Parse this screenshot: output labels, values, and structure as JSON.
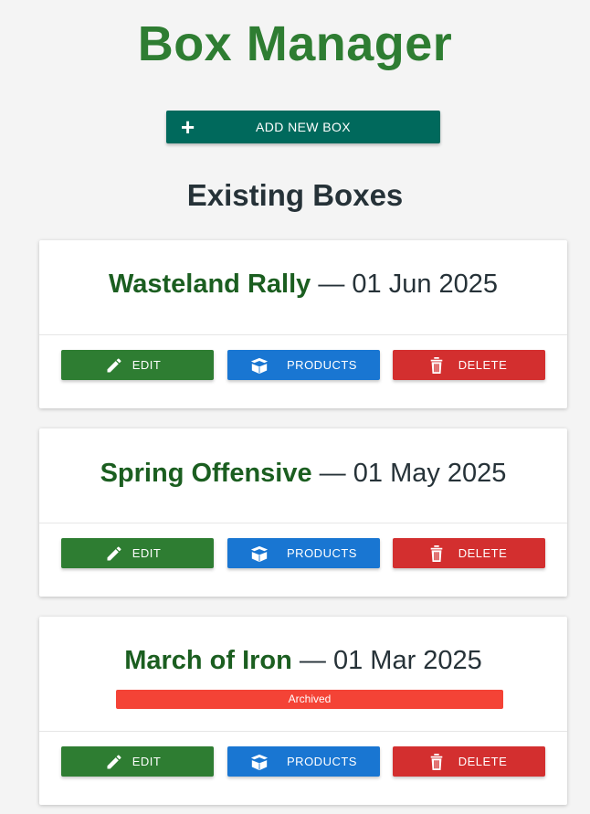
{
  "header": {
    "title": "Box Manager",
    "add_button_label": "ADD NEW BOX",
    "add_icon": "+"
  },
  "section": {
    "title": "Existing Boxes"
  },
  "boxes": [
    {
      "name": "Wasteland Rally",
      "separator": " — ",
      "date": "01 Jun 2025",
      "archived": false,
      "edit_label": "EDIT",
      "products_label": "PRODUCTS",
      "delete_label": "DELETE"
    },
    {
      "name": "Spring Offensive",
      "separator": " — ",
      "date": "01 May 2025",
      "archived": false,
      "edit_label": "EDIT",
      "products_label": "PRODUCTS",
      "delete_label": "DELETE"
    },
    {
      "name": "March of Iron",
      "separator": " — ",
      "date": "01 Mar 2025",
      "archived": true,
      "archived_label": "Archived",
      "edit_label": "EDIT",
      "products_label": "PRODUCTS",
      "delete_label": "DELETE"
    }
  ],
  "colors": {
    "title": "#2e7d32",
    "add_button": "#00695c",
    "edit": "#2e7d32",
    "products": "#1976d2",
    "delete": "#d32f2f",
    "archived": "#f44336"
  },
  "icons": {
    "add": "plus-icon",
    "edit": "pencil-icon",
    "products": "box-icon",
    "delete": "trash-icon"
  }
}
